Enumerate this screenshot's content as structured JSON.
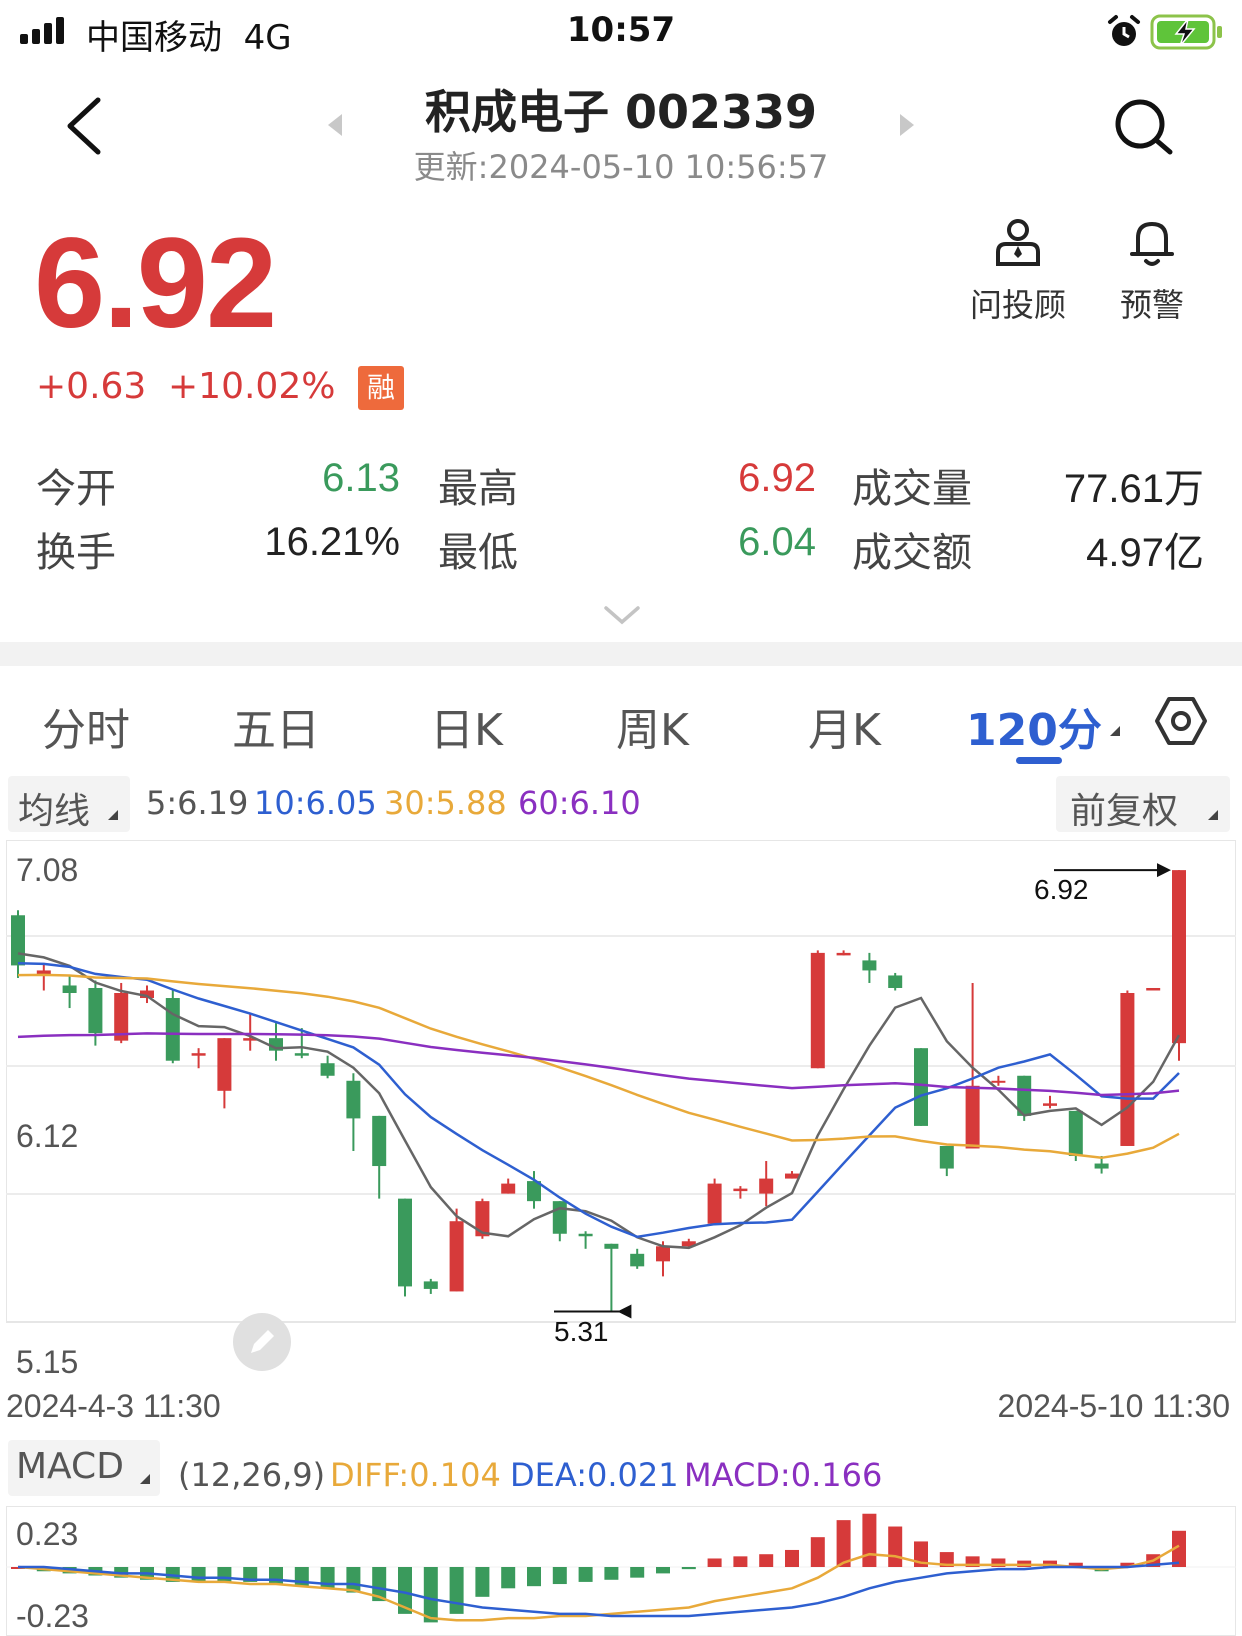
{
  "status_bar": {
    "carrier": "中国移动",
    "network": "4G",
    "time": "10:57"
  },
  "header": {
    "title": "积成电子 002339",
    "updated": "更新:2024-05-10 10:56:57"
  },
  "quote": {
    "price": "6.92",
    "change": "+0.63",
    "change_pct": "+10.02%",
    "margin_badge": "融",
    "actions": [
      {
        "label": "问投顾",
        "icon": "advisor-icon"
      },
      {
        "label": "预警",
        "icon": "bell-icon"
      }
    ],
    "stats": [
      {
        "label": "今开",
        "value": "6.13",
        "color": "#3a9a5c"
      },
      {
        "label": "最高",
        "value": "6.92",
        "color": "#d63a3a"
      },
      {
        "label": "成交量",
        "value": "77.61万",
        "color": "#222222"
      },
      {
        "label": "换手",
        "value": "16.21%",
        "color": "#222222"
      },
      {
        "label": "最低",
        "value": "6.04",
        "color": "#3a9a5c"
      },
      {
        "label": "成交额",
        "value": "4.97亿",
        "color": "#222222"
      }
    ]
  },
  "tabs": [
    {
      "label": "分时",
      "active": false
    },
    {
      "label": "五日",
      "active": false
    },
    {
      "label": "日K",
      "active": false
    },
    {
      "label": "周K",
      "active": false
    },
    {
      "label": "月K",
      "active": false
    },
    {
      "label": "120分",
      "active": true
    }
  ],
  "ma_bar": {
    "selector": "均线",
    "items": [
      {
        "text": "5:6.19",
        "color": "#555555"
      },
      {
        "text": "10:6.05",
        "color": "#2e5fd0"
      },
      {
        "text": "30:5.88",
        "color": "#e8a93a"
      },
      {
        "text": "60:6.10",
        "color": "#8a2fc0"
      }
    ],
    "adjust": "前复权"
  },
  "colors": {
    "up": "#d63a3a",
    "down": "#3a9a5c",
    "ma5": "#666666",
    "ma10": "#2e5fd0",
    "ma30": "#e8a93a",
    "ma60": "#8a2fc0",
    "accent": "#2e5fd0"
  },
  "chart_data": [
    {
      "type": "candlestick",
      "ylim": [
        5.15,
        7.08
      ],
      "ytick_labels": [
        "7.08",
        "6.12",
        "5.15"
      ],
      "x_start_label": "2024-4-3 11:30",
      "x_end_label": "2024-5-10 11:30",
      "annotations": {
        "high": "6.92",
        "low": "5.31"
      },
      "candles": [
        [
          6.74,
          6.76,
          6.49,
          6.54
        ],
        [
          6.5,
          6.55,
          6.44,
          6.52
        ],
        [
          6.46,
          6.5,
          6.37,
          6.43
        ],
        [
          6.45,
          6.48,
          6.22,
          6.27
        ],
        [
          6.24,
          6.47,
          6.23,
          6.43
        ],
        [
          6.41,
          6.46,
          6.39,
          6.44
        ],
        [
          6.41,
          6.44,
          6.15,
          6.16
        ],
        [
          6.18,
          6.21,
          6.13,
          6.19
        ],
        [
          6.04,
          6.25,
          5.97,
          6.25
        ],
        [
          6.24,
          6.35,
          6.2,
          6.25
        ],
        [
          6.25,
          6.31,
          6.16,
          6.2
        ],
        [
          6.19,
          6.29,
          6.17,
          6.18
        ],
        [
          6.15,
          6.18,
          6.09,
          6.1
        ],
        [
          6.08,
          6.11,
          5.8,
          5.93
        ],
        [
          5.94,
          5.94,
          5.61,
          5.74
        ],
        [
          5.61,
          5.61,
          5.22,
          5.26
        ],
        [
          5.28,
          5.29,
          5.23,
          5.25
        ],
        [
          5.24,
          5.57,
          5.24,
          5.52
        ],
        [
          5.46,
          5.61,
          5.45,
          5.6
        ],
        [
          5.63,
          5.69,
          5.63,
          5.67
        ],
        [
          5.68,
          5.72,
          5.57,
          5.6
        ],
        [
          5.6,
          5.6,
          5.44,
          5.47
        ],
        [
          5.47,
          5.48,
          5.41,
          5.46
        ],
        [
          5.43,
          5.43,
          5.16,
          5.41
        ],
        [
          5.39,
          5.41,
          5.33,
          5.34
        ],
        [
          5.36,
          5.44,
          5.3,
          5.42
        ],
        [
          5.42,
          5.45,
          5.41,
          5.44
        ],
        [
          5.51,
          5.69,
          5.51,
          5.67
        ],
        [
          5.64,
          5.66,
          5.61,
          5.65
        ],
        [
          5.63,
          5.76,
          5.58,
          5.69
        ],
        [
          5.69,
          5.72,
          5.69,
          5.71
        ],
        [
          6.13,
          6.6,
          6.13,
          6.59
        ],
        [
          6.58,
          6.6,
          6.58,
          6.59
        ],
        [
          6.56,
          6.59,
          6.47,
          6.52
        ],
        [
          6.5,
          6.51,
          6.44,
          6.45
        ],
        [
          6.21,
          6.21,
          5.9,
          5.9
        ],
        [
          5.82,
          5.82,
          5.7,
          5.73
        ],
        [
          5.81,
          6.47,
          5.81,
          6.06
        ],
        [
          6.08,
          6.1,
          6.06,
          6.08
        ],
        [
          6.1,
          6.1,
          5.92,
          5.94
        ],
        [
          5.98,
          6.02,
          5.97,
          5.99
        ],
        [
          5.96,
          5.96,
          5.76,
          5.78
        ],
        [
          5.75,
          5.78,
          5.71,
          5.73
        ],
        [
          5.82,
          6.44,
          5.82,
          6.43
        ],
        [
          6.44,
          6.45,
          6.44,
          6.45
        ],
        [
          6.23,
          6.92,
          6.16,
          6.92
        ]
      ]
    },
    {
      "type": "bar",
      "title": "MACD",
      "params": "(12,26,9)",
      "ylim": [
        -0.23,
        0.23
      ],
      "ytick_labels": [
        "0.23",
        "-0.23"
      ],
      "series": [
        {
          "name": "DIFF",
          "value_label": "0.104"
        },
        {
          "name": "DEA",
          "value_label": "0.021"
        },
        {
          "name": "MACD",
          "value_label": "0.166"
        }
      ],
      "macd": [
        0.0,
        -0.02,
        -0.03,
        -0.04,
        -0.05,
        -0.06,
        -0.07,
        -0.07,
        -0.07,
        -0.07,
        -0.08,
        -0.09,
        -0.1,
        -0.12,
        -0.16,
        -0.22,
        -0.26,
        -0.22,
        -0.14,
        -0.1,
        -0.09,
        -0.08,
        -0.07,
        -0.06,
        -0.05,
        -0.03,
        -0.01,
        0.04,
        0.05,
        0.06,
        0.08,
        0.14,
        0.22,
        0.25,
        0.19,
        0.12,
        0.07,
        0.05,
        0.04,
        0.03,
        0.03,
        0.02,
        -0.02,
        0.02,
        0.06,
        0.17
      ],
      "diff": [
        0.0,
        -0.01,
        -0.02,
        -0.03,
        -0.04,
        -0.05,
        -0.06,
        -0.07,
        -0.07,
        -0.08,
        -0.08,
        -0.09,
        -0.1,
        -0.11,
        -0.14,
        -0.19,
        -0.24,
        -0.25,
        -0.25,
        -0.24,
        -0.24,
        -0.23,
        -0.23,
        -0.22,
        -0.21,
        -0.2,
        -0.19,
        -0.16,
        -0.14,
        -0.12,
        -0.1,
        -0.05,
        0.02,
        0.06,
        0.05,
        0.02,
        0.01,
        0.01,
        0.01,
        0.01,
        0.01,
        0.0,
        -0.01,
        0.0,
        0.03,
        0.1
      ],
      "dea": [
        0.0,
        0.0,
        -0.01,
        -0.02,
        -0.03,
        -0.03,
        -0.04,
        -0.05,
        -0.05,
        -0.06,
        -0.06,
        -0.07,
        -0.08,
        -0.08,
        -0.1,
        -0.12,
        -0.15,
        -0.17,
        -0.19,
        -0.2,
        -0.21,
        -0.22,
        -0.22,
        -0.23,
        -0.23,
        -0.23,
        -0.23,
        -0.22,
        -0.21,
        -0.2,
        -0.19,
        -0.17,
        -0.14,
        -0.1,
        -0.07,
        -0.05,
        -0.03,
        -0.02,
        -0.01,
        -0.01,
        0.0,
        0.0,
        0.0,
        0.0,
        0.01,
        0.02
      ]
    }
  ]
}
